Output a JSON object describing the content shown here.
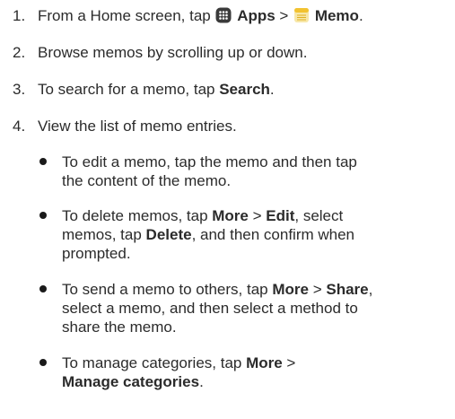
{
  "steps": [
    {
      "number": "1.",
      "text_a": "From a Home screen, tap ",
      "icon_apps": "apps-grid-icon",
      "bold_apps": "Apps",
      "sep": " > ",
      "icon_memo": "memo-notepad-icon",
      "bold_memo": "Memo",
      "end": "."
    },
    {
      "number": "2.",
      "text": "Browse memos by scrolling up or down."
    },
    {
      "number": "3.",
      "text_a": "To search for a memo, tap ",
      "bold": "Search",
      "end": "."
    },
    {
      "number": "4.",
      "text": "View the list of memo entries."
    }
  ],
  "bullets": [
    {
      "line1": "To edit a memo, tap the memo and then tap",
      "line2": "the content of the memo."
    },
    {
      "l1a": "To delete memos, tap ",
      "l1b": "More",
      "l1c": " > ",
      "l1d": "Edit",
      "l1e": ", select",
      "l2a": "memos, tap ",
      "l2b": "Delete",
      "l2c": ", and then confirm when",
      "l3": "prompted."
    },
    {
      "l1a": "To send a memo to others, tap ",
      "l1b": "More",
      "l1c": " > ",
      "l1d": "Share",
      "l1e": ",",
      "l2": "select a memo, and then select a method to",
      "l3": "share the memo."
    },
    {
      "l1a": "To manage categories, tap ",
      "l1b": "More",
      "l1c": " >",
      "l2b": "Manage categories",
      "l2c": "."
    }
  ],
  "colors": {
    "text": "#2b2b2b",
    "apps_icon": "#3a3a3a",
    "memo_icon": "#f2c230"
  }
}
